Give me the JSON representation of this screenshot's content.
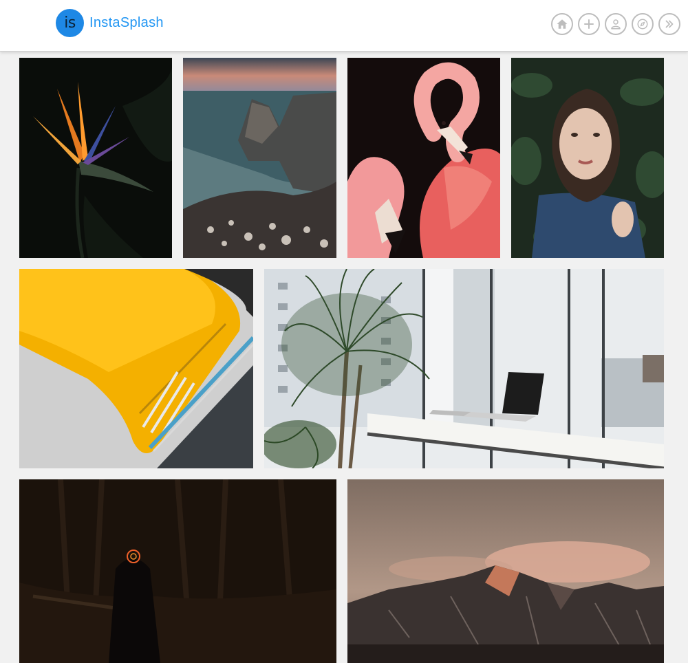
{
  "header": {
    "logo_badge": "is",
    "logo_text": "InstaSplash",
    "nav": [
      {
        "icon": "home-icon"
      },
      {
        "icon": "plus-icon"
      },
      {
        "icon": "user-icon"
      },
      {
        "icon": "compass-icon"
      },
      {
        "icon": "double-chevron-right-icon"
      }
    ]
  },
  "colors": {
    "brand": "#2196f3",
    "nav_icon": "#bdbdbd",
    "background": "#f1f1f1"
  },
  "gallery": [
    {
      "subject": "bird-of-paradise-flower"
    },
    {
      "subject": "coastal-sea-cliffs"
    },
    {
      "subject": "pink-flamingos"
    },
    {
      "subject": "woman-in-leaves"
    },
    {
      "subject": "yellow-car-fender"
    },
    {
      "subject": "office-with-palm-and-laptop"
    },
    {
      "subject": "figure-in-dark-forest"
    },
    {
      "subject": "mountain-peaks-at-sunset"
    }
  ]
}
